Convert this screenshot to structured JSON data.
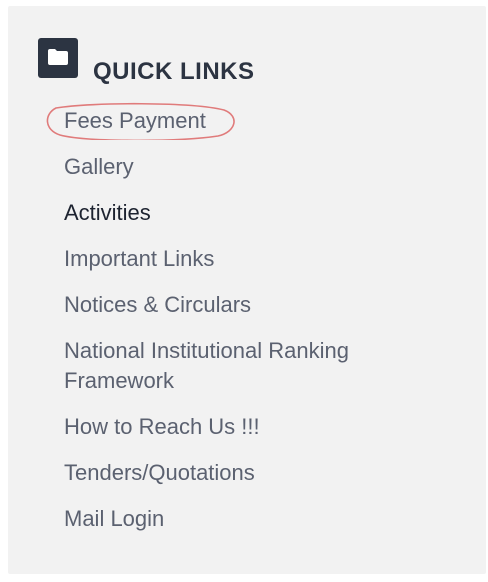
{
  "header": {
    "icon": "folder-icon",
    "title": "QUICK LINKS"
  },
  "links": [
    {
      "label": "Fees Payment"
    },
    {
      "label": "Gallery"
    },
    {
      "label": "Activities"
    },
    {
      "label": "Important Links"
    },
    {
      "label": "Notices & Circulars"
    },
    {
      "label": "National Institutional Ranking Framework"
    },
    {
      "label": "How to Reach Us !!!"
    },
    {
      "label": "Tenders/Quotations"
    },
    {
      "label": "Mail Login"
    }
  ],
  "colors": {
    "panel_bg": "#f2f2f2",
    "heading": "#2c3442",
    "link": "#5b6170",
    "active_link": "#1d2330",
    "annotation_circle": "#e07b7b"
  }
}
